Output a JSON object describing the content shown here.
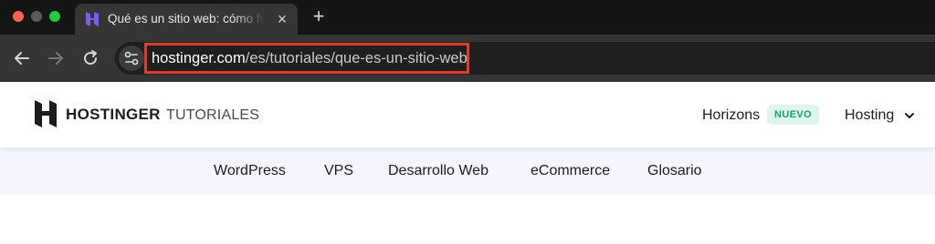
{
  "browser": {
    "tab": {
      "title": "Qué es un sitio web: cómo funciona y cuáles son sus tipos",
      "close_glyph": "×",
      "favicon": "hostinger-favicon"
    },
    "new_tab_glyph": "+",
    "address_bar": {
      "url_host": "hostinger.com",
      "url_path": "/es/tutoriales/que-es-un-sitio-web",
      "highlight_color": "#e23b2a"
    },
    "icons": [
      "arrow-left-icon",
      "arrow-right-icon",
      "reload-icon",
      "site-settings-icon"
    ]
  },
  "site": {
    "brand": "HOSTINGER",
    "brand_sub": "TUTORIALES",
    "nav": {
      "horizons": "Horizons",
      "badge": "NUEVO",
      "hosting": "Hosting"
    },
    "subnav": [
      "WordPress",
      "VPS",
      "Desarrollo Web",
      "eCommerce",
      "Glosario"
    ],
    "colors": {
      "badge_bg": "#dff5ec",
      "badge_text": "#16a36b",
      "subnav_bg": "#f4f5ff"
    }
  }
}
